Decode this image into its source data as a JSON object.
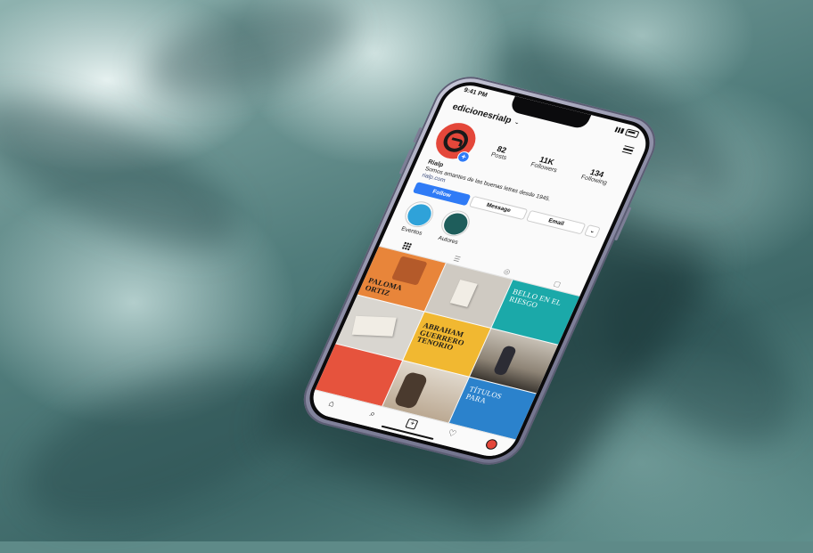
{
  "status_bar": {
    "time": "9:41 PM"
  },
  "profile": {
    "username": "edicionesrialp",
    "stats": [
      {
        "value": "82",
        "label": "Posts"
      },
      {
        "value": "11K",
        "label": "Followers"
      },
      {
        "value": "134",
        "label": "Following"
      }
    ],
    "name": "Rialp",
    "bio": "Somos amantes de las buenas letras desde 1945.",
    "link": "rialp.com"
  },
  "actions": {
    "follow": "Follow",
    "message": "Message",
    "email": "Email",
    "more": "⌄"
  },
  "highlights": [
    {
      "label": "Eventos",
      "color": "#2fa2d9"
    },
    {
      "label": "Autores",
      "color": "#1e5d5b"
    }
  ],
  "posts": [
    {
      "text": "PALOMA ORTIZ",
      "small": "",
      "style": "orange"
    },
    {
      "text": "",
      "small": "",
      "style": "book"
    },
    {
      "text": "BELLO EN EL RIESGO",
      "small": "",
      "style": "teal"
    },
    {
      "text": "",
      "small": "",
      "style": "gray"
    },
    {
      "text": "ABRAHAM GUERRERO TENORIO",
      "small": "",
      "style": "yellow"
    },
    {
      "text": "",
      "small": "",
      "style": "photo"
    },
    {
      "text": "",
      "small": "",
      "style": "red"
    },
    {
      "text": "",
      "small": "",
      "style": "mix"
    },
    {
      "text": "TÍTULOS PARA",
      "small": "",
      "style": "blue"
    }
  ],
  "colors": {
    "accent": "#2f7bf6",
    "brand": "#e4473a"
  },
  "icons": {
    "menu": "hamburger-icon",
    "grid": "grid-icon",
    "reels": "reels-icon",
    "tagged": "tagged-icon",
    "home": "home-icon",
    "search": "search-icon",
    "add": "plus-square-icon",
    "heart": "heart-icon"
  }
}
